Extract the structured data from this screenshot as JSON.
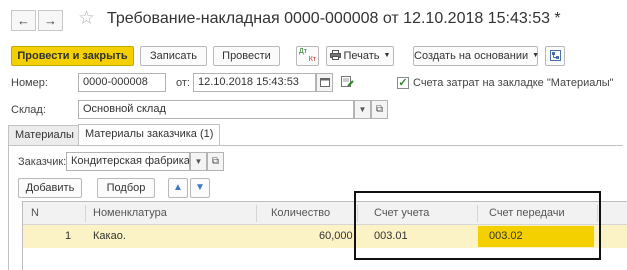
{
  "window": {
    "title": "Требование-накладная 0000-000008 от 12.10.2018 15:43:53 *",
    "back_icon": "←",
    "forward_icon": "→",
    "favorite_icon": "☆"
  },
  "toolbar": {
    "post_close": "Провести и закрыть",
    "save": "Записать",
    "post": "Провести",
    "dtkt_top": "Дт",
    "dtkt_bottom": "Кт",
    "print": "Печать",
    "create_based": "Создать на основании",
    "caret": "▼"
  },
  "form": {
    "number_label": "Номер:",
    "number_value": "0000-000008",
    "date_label": "от:",
    "date_value": "12.10.2018 15:43:53",
    "checkbox_mark": "✓",
    "checkbox_label": "Счета затрат на закладке \"Материалы\"",
    "warehouse_label": "Склад:",
    "warehouse_value": "Основной склад",
    "select_dots": "...",
    "open_icon": "⧉"
  },
  "tabs": [
    {
      "label": "Материалы"
    },
    {
      "label": "Материалы заказчика (1)"
    }
  ],
  "customer": {
    "label": "Заказчик:",
    "value": "Кондитерская фабрика \"З"
  },
  "table_toolbar": {
    "add": "Добавить",
    "pick": "Подбор",
    "up": "▲",
    "down": "▼"
  },
  "table": {
    "headers": [
      "N",
      "Номенклатура",
      "Количество",
      "Счет учета",
      "Счет передачи"
    ],
    "rows": [
      {
        "n": "1",
        "item": "Какао.",
        "qty": "60,000",
        "account": "003.01",
        "transfer_account": "003.02"
      }
    ]
  },
  "colors": {
    "accent": "#f5d000",
    "row_highlight": "#fbf2c6"
  }
}
